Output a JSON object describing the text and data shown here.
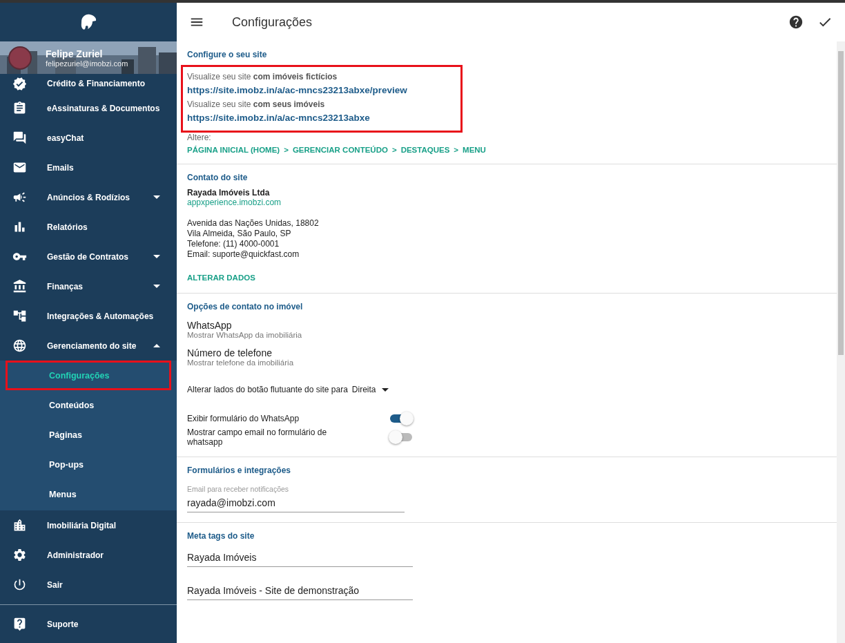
{
  "sidebar": {
    "user": {
      "name": "Felipe Zuriel",
      "email": "felipezuriel@imobzi.com"
    },
    "items": [
      {
        "label": "Crédito & Financiamento"
      },
      {
        "label": "eAssinaturas & Documentos"
      },
      {
        "label": "easyChat"
      },
      {
        "label": "Emails"
      },
      {
        "label": "Anúncios & Rodízios",
        "expanded": false
      },
      {
        "label": "Relatórios"
      },
      {
        "label": "Gestão de Contratos",
        "expanded": false
      },
      {
        "label": "Finanças",
        "expanded": false
      },
      {
        "label": "Integrações & Automações"
      },
      {
        "label": "Gerenciamento do site",
        "expanded": true,
        "children": [
          {
            "label": "Configurações",
            "selected": true,
            "highlighted": true
          },
          {
            "label": "Conteúdos",
            "selected": false,
            "highlighted": false
          },
          {
            "label": "Páginas",
            "selected": false,
            "highlighted": false
          },
          {
            "label": "Pop-ups",
            "selected": false,
            "highlighted": false
          },
          {
            "label": "Menus",
            "selected": false,
            "highlighted": false
          }
        ]
      },
      {
        "label": "Imobiliária Digital"
      },
      {
        "label": "Administrador"
      },
      {
        "label": "Sair"
      }
    ],
    "footer": {
      "label": "Suporte"
    }
  },
  "header": {
    "title": "Configurações"
  },
  "site": {
    "title": "Configure o seu site",
    "highlighted": true,
    "previews": [
      {
        "caption": "Visualize seu site **com imóveis fictícios**",
        "url": "https://site.imobz.in/a/ac-mncs23213abxe/preview"
      },
      {
        "caption": "Visualize seu site **com seus imóveis**",
        "url": "https://site.imobz.in/a/ac-mncs23213abxe"
      }
    ],
    "change_label": "Altere:",
    "breadcrumbs": [
      "PÁGINA INICIAL (HOME)",
      ">",
      "GERENCIAR CONTEÚDO",
      ">",
      "DESTAQUES",
      ">",
      "MENU"
    ]
  },
  "contact": {
    "title": "Contato do site",
    "company": "Rayada Imóveis Ltda",
    "domain": "appxperience.imobzi.com",
    "address": [
      "Avenida das Nações Unidas, 18802",
      "Vila Almeida, São Paulo, SP",
      "Telefone: (11) 4000-0001",
      "Email: suporte@quickfast.com"
    ],
    "action": "ALTERAR DADOS"
  },
  "contact_options": {
    "title": "Opções de contato no imóvel",
    "options": [
      {
        "title": "WhatsApp",
        "subtitle": "Mostrar WhatsApp da imobiliária"
      },
      {
        "title": "Número de telefone",
        "subtitle": "Mostrar telefone da imobiliária"
      }
    ],
    "float_label": "Alterar lados do botão flutuante do site para",
    "float_value": "Direita",
    "toggles": [
      {
        "label": "Exibir formulário do WhatsApp",
        "on": true
      },
      {
        "label": "Mostrar campo email no formulário de whatsapp",
        "on": false
      }
    ]
  },
  "forms": {
    "title": "Formulários e integrações",
    "label": "Email para receber notificações",
    "value": "rayada@imobzi.com"
  },
  "meta": {
    "title": "Meta tags do site",
    "fields": [
      "Rayada Imóveis",
      "Rayada Imóveis - Site de demonstração"
    ]
  }
}
